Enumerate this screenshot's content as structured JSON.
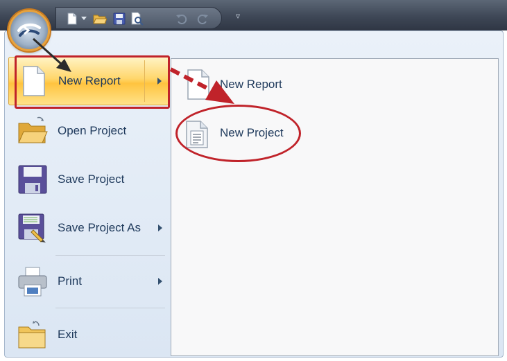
{
  "orb": {
    "icon": "application-orb-icon"
  },
  "quick_access": {
    "buttons": [
      {
        "name": "new-document-icon"
      },
      {
        "name": "dropdown-arrow-icon"
      },
      {
        "name": "open-folder-icon"
      },
      {
        "name": "save-icon"
      },
      {
        "name": "print-preview-icon"
      },
      {
        "name": "undo-icon"
      },
      {
        "name": "redo-icon"
      }
    ],
    "customize_glyph": "▿"
  },
  "menu": {
    "items": [
      {
        "label": "New Report",
        "icon": "blank-page-icon",
        "has_submenu": true,
        "selected": true
      },
      {
        "label": "Open Project",
        "icon": "open-folder-icon",
        "has_submenu": false
      },
      {
        "label": "Save Project",
        "icon": "floppy-disk-icon",
        "has_submenu": false
      },
      {
        "label": "Save Project As",
        "icon": "floppy-disk-pencil-icon",
        "has_submenu": true
      },
      {
        "label": "Print",
        "icon": "printer-icon",
        "has_submenu": true
      },
      {
        "label": "Exit",
        "icon": "exit-folder-icon",
        "has_submenu": false
      }
    ]
  },
  "submenu": {
    "items": [
      {
        "label": "New Report",
        "icon": "blank-page-icon"
      },
      {
        "label": "New Project",
        "icon": "document-lines-icon",
        "highlighted": true
      }
    ]
  },
  "annotations": {
    "color": "#c0232a",
    "arrow_color": "#2b2b2b"
  }
}
